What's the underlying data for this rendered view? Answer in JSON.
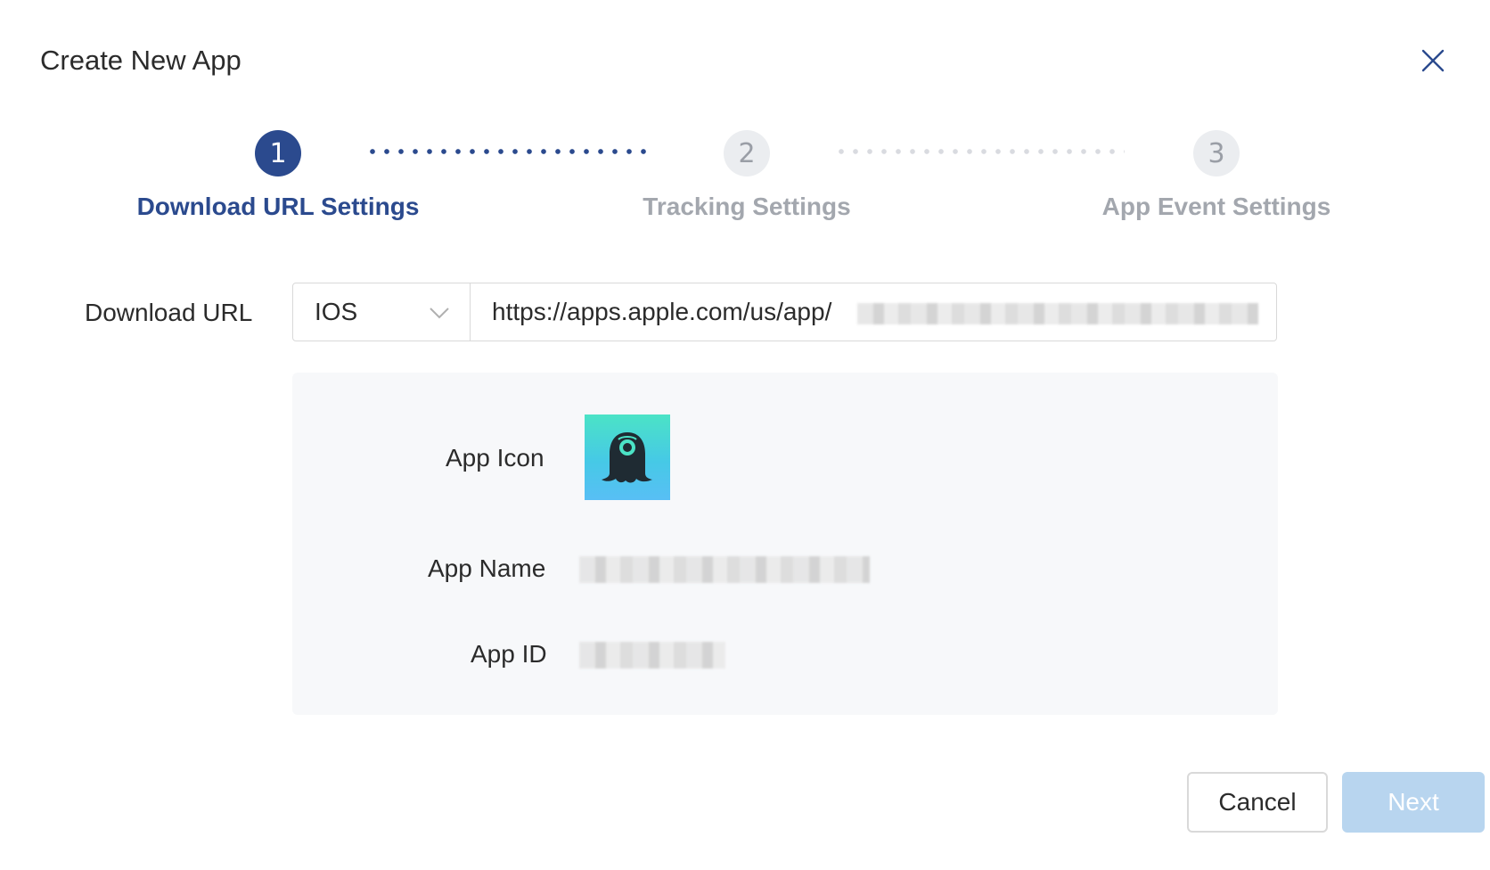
{
  "dialog": {
    "title": "Create New App"
  },
  "steps": [
    {
      "number": "1",
      "label": "Download URL Settings",
      "state": "active"
    },
    {
      "number": "2",
      "label": "Tracking Settings",
      "state": "inactive"
    },
    {
      "number": "3",
      "label": "App Event Settings",
      "state": "inactive"
    }
  ],
  "form": {
    "download_url_label": "Download URL",
    "platform_selected": "IOS",
    "url_value_prefix": "https://apps.apple.com/us/app/"
  },
  "app_info": {
    "icon_label": "App Icon",
    "name_label": "App Name",
    "id_label": "App ID"
  },
  "footer": {
    "cancel_label": "Cancel",
    "next_label": "Next"
  },
  "colors": {
    "primary": "#2b4a8e",
    "inactive_step": "#ebedf0",
    "next_disabled": "#b8d5ef",
    "panel_bg": "#f7f8fa"
  },
  "icons": {
    "close": "close-icon",
    "dropdown": "chevron-down-icon",
    "app": "app-icon-image"
  }
}
